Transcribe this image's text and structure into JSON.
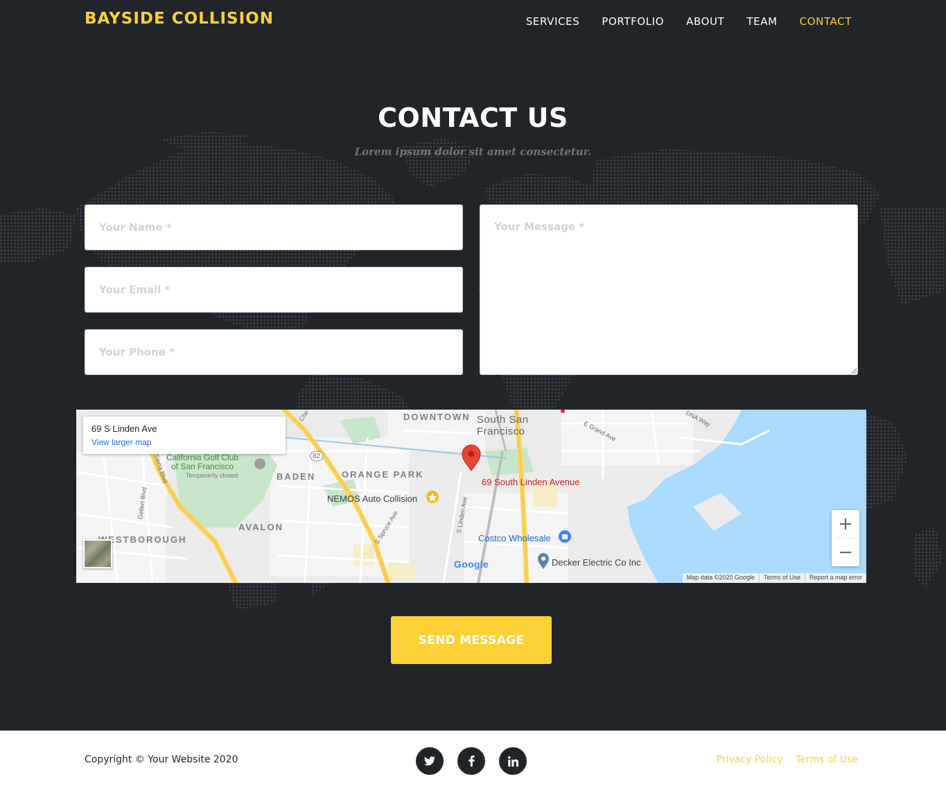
{
  "colors": {
    "brand": "#fed136",
    "section_bg": "#212529",
    "white": "#ffffff",
    "muted": "#6c757d"
  },
  "nav": {
    "brand": "BAYSIDE COLLISION",
    "items": [
      {
        "label": "SERVICES",
        "active": false
      },
      {
        "label": "PORTFOLIO",
        "active": false
      },
      {
        "label": "ABOUT",
        "active": false
      },
      {
        "label": "TEAM",
        "active": false
      },
      {
        "label": "CONTACT",
        "active": true
      }
    ]
  },
  "contact": {
    "heading": "CONTACT US",
    "subheading": "Lorem ipsum dolor sit amet consectetur.",
    "name_placeholder": "Your Name *",
    "email_placeholder": "Your Email *",
    "phone_placeholder": "Your Phone *",
    "message_placeholder": "Your Message *",
    "send_label": "SEND MESSAGE"
  },
  "map": {
    "info_title": "69 S Linden Ave",
    "info_link": "View larger map",
    "marker_label": "69 South Linden Avenue",
    "districts": [
      "DOWNTOWN",
      "BADEN",
      "ORANGE PARK",
      "AVALON",
      "WESTBOROUGH"
    ],
    "city": [
      "South San",
      "Francisco"
    ],
    "golf": [
      "California Golf Club",
      "of San Francisco"
    ],
    "golf_status": "Temporarily closed",
    "nemos": "NEMOS Auto Collision",
    "costco": "Costco Wholesale",
    "decker": "Decker Electric Co Inc",
    "streets": {
      "e_grand": "E Grand Ave",
      "dna_way": "DNA Way",
      "linden": "S Linden Ave",
      "spruce": "S Spruce Ave",
      "gellert": "Gellert Blvd",
      "sierra": "Sierra Blvd",
      "hwy": "82",
      "che": "Che"
    },
    "google": "Google",
    "footer": [
      "Map data ©2020 Google",
      "Terms of Use",
      "Report a map error"
    ],
    "zoom_in": "+",
    "zoom_out": "−"
  },
  "footer": {
    "copyright": "Copyright © Your Website 2020",
    "social": [
      "twitter-icon",
      "facebook-icon",
      "linkedin-icon"
    ],
    "links": [
      "Privacy Policy",
      "Terms of Use"
    ]
  }
}
